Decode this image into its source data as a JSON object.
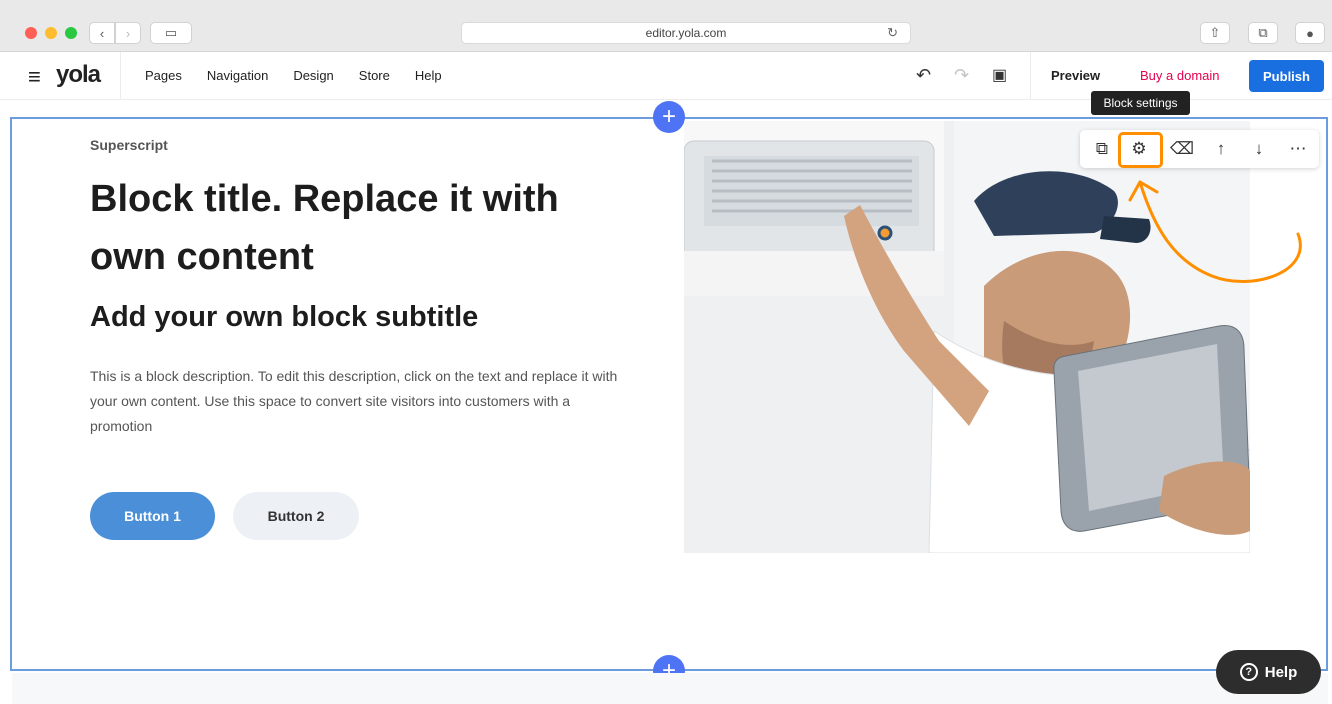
{
  "browser": {
    "url": "editor.yola.com",
    "icons": [
      "back-icon",
      "forward-icon",
      "sidebar-icon",
      "reload-icon",
      "share-icon",
      "tabs-icon",
      "download-icon"
    ]
  },
  "editor": {
    "logo": "yola",
    "menu": [
      "Pages",
      "Navigation",
      "Design",
      "Store",
      "Help"
    ],
    "preview": "Preview",
    "buy_domain": "Buy a domain",
    "publish": "Publish"
  },
  "block": {
    "superscript": "Superscript",
    "title": "Block title. Replace it with own content",
    "subtitle": "Add your own block subtitle",
    "description": "This is a block description. To edit this description, click on the text and replace it with your own content. Use this space to convert site visitors into customers with a promotion",
    "button1": "Button 1",
    "button2": "Button 2"
  },
  "toolbar": {
    "tooltip": "Block settings",
    "icons": [
      "copy-icon",
      "gear-icon",
      "delete-icon",
      "move-up-icon",
      "move-down-icon",
      "more-icon"
    ],
    "highlight_color": "#ff8f00"
  },
  "help": {
    "label": "Help",
    "icon": "help-icon"
  },
  "colors": {
    "publish": "#1a6fe0",
    "buy_domain": "#e5004d",
    "add_block": "#4f73f5",
    "button1": "#4a8fd8",
    "selection": "#6d9be0"
  }
}
